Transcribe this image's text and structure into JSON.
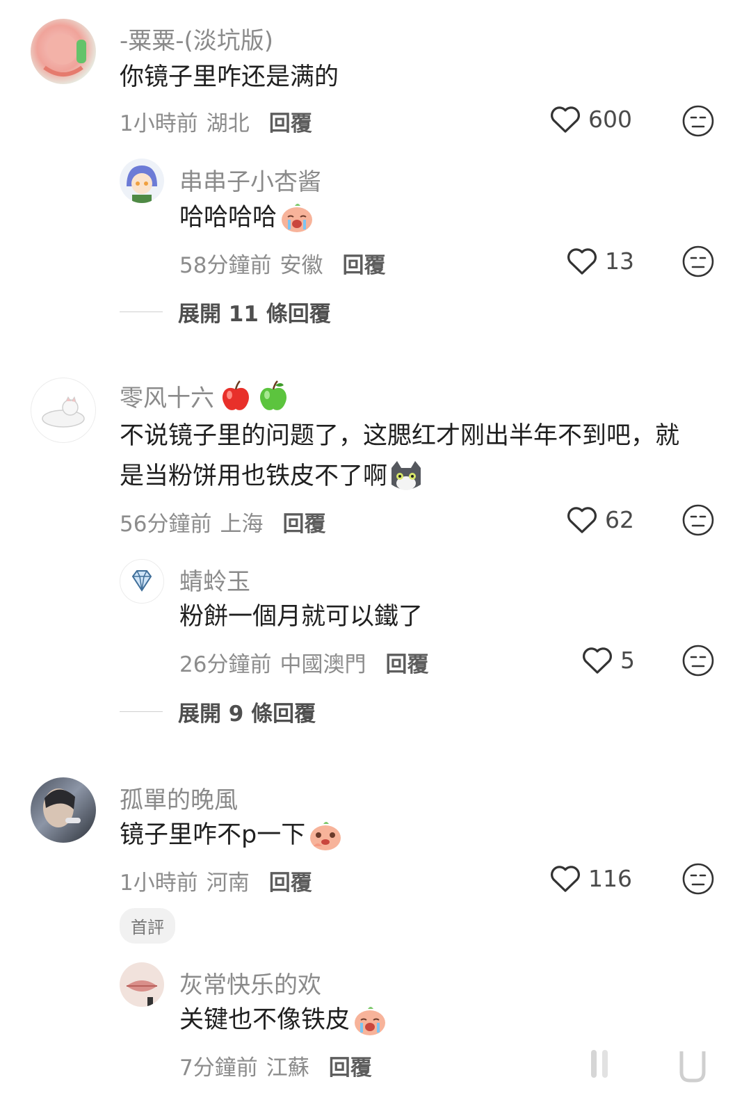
{
  "comments": [
    {
      "name": "-粟粟-(淡坑版)",
      "text": "你镜子里咋还是满的",
      "time": "1小時前",
      "location": "湖北",
      "reply_label": "回覆",
      "likes": "600",
      "reply": {
        "name": "串串子小杏酱",
        "text": "哈哈哈哈",
        "time": "58分鐘前",
        "location": "安徽",
        "reply_label": "回覆",
        "likes": "13"
      },
      "expand": "展開 11 條回覆"
    },
    {
      "name": "零风十六",
      "text_line1": "不说镜子里的问题了，这腮红才刚出半年不到吧，就",
      "text_line2": "是当粉饼用也铁皮不了啊",
      "time": "56分鐘前",
      "location": "上海",
      "reply_label": "回覆",
      "likes": "62",
      "reply": {
        "name": "蜻蛉玉",
        "text": "粉餅一個月就可以鐵了",
        "time": "26分鐘前",
        "location": "中國澳門",
        "reply_label": "回覆",
        "likes": "5"
      },
      "expand": "展開 9 條回覆"
    },
    {
      "name": "孤單的晚風",
      "text": "镜子里咋不p一下",
      "time": "1小時前",
      "location": "河南",
      "reply_label": "回覆",
      "likes": "116",
      "badge": "首評",
      "reply": {
        "name": "灰常快乐的欢",
        "text": "关键也不像铁皮",
        "time": "7分鐘前",
        "location": "江蘇",
        "reply_label": "回覆"
      }
    }
  ],
  "icons": {
    "like": "heart-outline-icon",
    "react": "neutral-face-icon"
  }
}
